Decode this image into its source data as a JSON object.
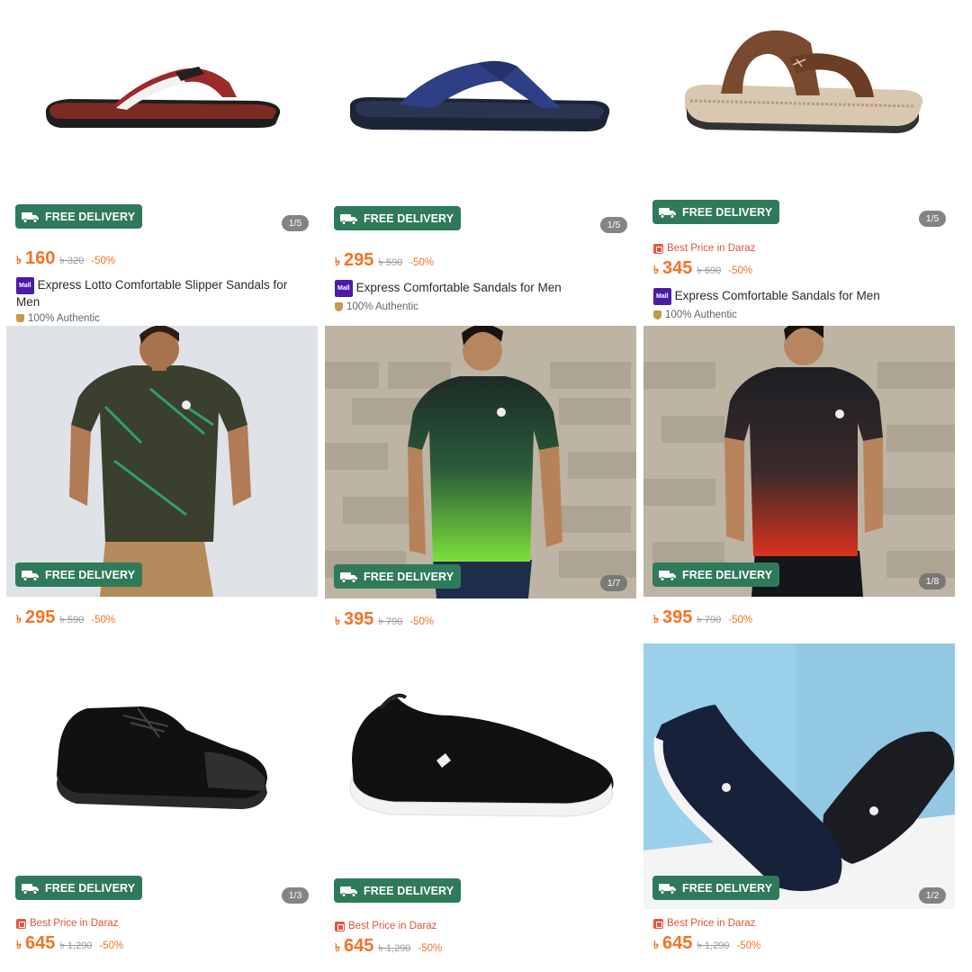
{
  "currency_symbol": "৳",
  "colors": {
    "delivery_badge": "#2f7a5a",
    "price": "#f57224",
    "best_price": "#e0533e",
    "mall_badge": "#4b1ba8"
  },
  "products": [
    {
      "image": "flip-flop-red-sandal",
      "delivery_label": "FREE DELIVERY",
      "image_counter": "1/5",
      "best_price_label": "",
      "price": "160",
      "original_price": "৳ 320",
      "discount": "-50%",
      "mall_badge": "Mall",
      "title": "Express Lotto Comfortable Slipper Sandals for Men",
      "authentic_label": "100% Authentic"
    },
    {
      "image": "flip-flop-navy-sandal",
      "delivery_label": "FREE DELIVERY",
      "image_counter": "1/5",
      "best_price_label": "",
      "price": "295",
      "original_price": "৳ 590",
      "discount": "-50%",
      "mall_badge": "Mall",
      "title": "Express Comfortable Sandals for Men",
      "authentic_label": "100% Authentic"
    },
    {
      "image": "brown-leather-sandal",
      "delivery_label": "FREE DELIVERY",
      "image_counter": "1/5",
      "best_price_label": "Best Price in Daraz",
      "price": "345",
      "original_price": "৳ 690",
      "discount": "-50%",
      "mall_badge": "Mall",
      "title": "Express Comfortable Sandals for Men",
      "authentic_label": "100% Authentic"
    },
    {
      "image": "olive-sport-tshirt",
      "delivery_label": "FREE DELIVERY",
      "image_counter": "",
      "price": "295",
      "original_price": "৳ 590",
      "discount": "-50%"
    },
    {
      "image": "green-gradient-sport-tshirt",
      "delivery_label": "FREE DELIVERY",
      "image_counter": "1/7",
      "price": "395",
      "original_price": "৳ 790",
      "discount": "-50%"
    },
    {
      "image": "red-gradient-sport-tshirt",
      "delivery_label": "FREE DELIVERY",
      "image_counter": "1/8",
      "price": "395",
      "original_price": "৳ 790",
      "discount": "-50%"
    },
    {
      "image": "black-canvas-sneaker",
      "delivery_label": "FREE DELIVERY",
      "image_counter": "1/3",
      "best_price_label": "Best Price in Daraz",
      "price": "645",
      "original_price": "৳ 1,290",
      "discount": "-50%"
    },
    {
      "image": "black-slip-on-shoe",
      "delivery_label": "FREE DELIVERY",
      "image_counter": "",
      "best_price_label": "Best Price in Daraz",
      "price": "645",
      "original_price": "৳ 1,290",
      "discount": "-50%"
    },
    {
      "image": "navy-slip-on-shoe-pair",
      "delivery_label": "FREE DELIVERY",
      "image_counter": "1/2",
      "best_price_label": "Best Price in Daraz",
      "price": "645",
      "original_price": "৳ 1,290",
      "discount": "-50%"
    }
  ]
}
